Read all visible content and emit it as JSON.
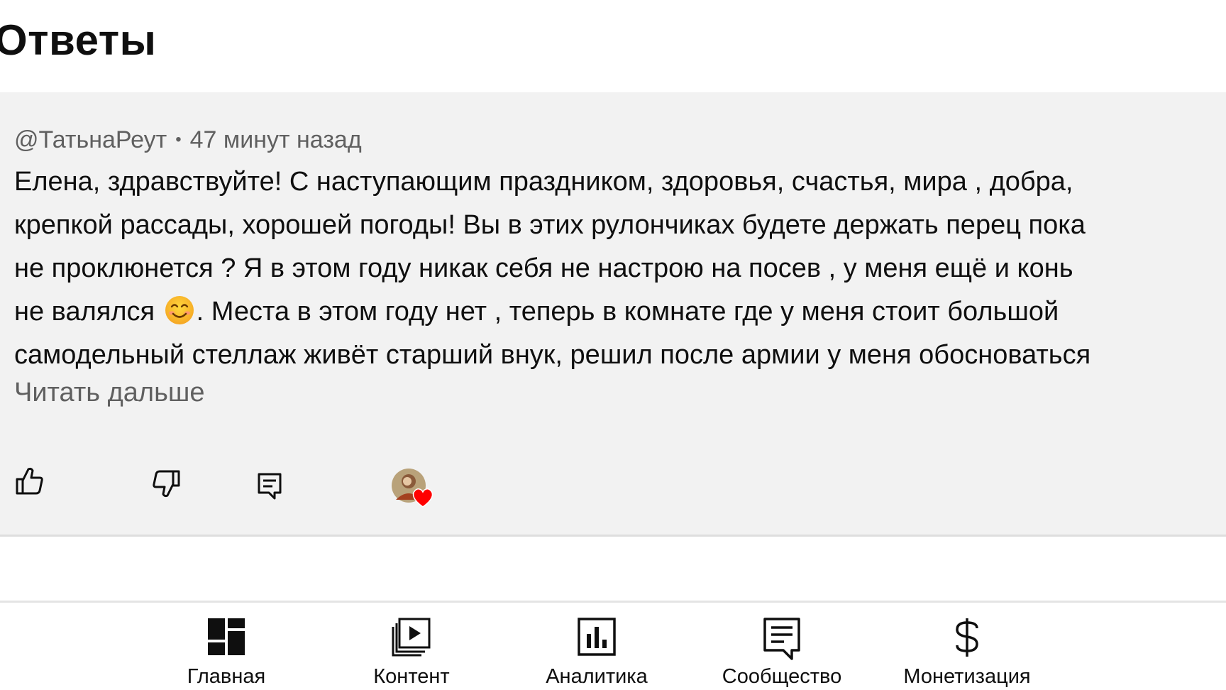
{
  "page": {
    "title": "Ответы"
  },
  "comment": {
    "author": "@ТатьнаРеут",
    "separator": "•",
    "time": "47 минут назад",
    "lines": [
      "Елена, здравствуйте! С наступающим праздником, здоровья, счастья, мира , добра,",
      "крепкой рассады, хорошей погоды! Вы в этих рулончиках будете держать перец пока",
      "не проклюнется ? Я в этом году никак себя не настрою на посев , у меня ещё и конь",
      "не валялся",
      ". Места в этом году нет , теперь в комнате где у меня стоит большой",
      "самодельный стеллаж живёт старший внук, решил после армии у меня обосноваться"
    ],
    "emoji": "smiling-face-emoji",
    "read_more": "Читать дальше",
    "actions": {
      "like_icon": "thumb-up-icon",
      "dislike_icon": "thumb-down-icon",
      "reply_icon": "reply-comment-icon",
      "hearted_icon": "creator-heart-icon",
      "heart_color": "#ff0000"
    }
  },
  "bottom_nav": {
    "items": [
      {
        "label": "Главная",
        "icon": "dashboard-icon"
      },
      {
        "label": "Контент",
        "icon": "content-library-icon"
      },
      {
        "label": "Аналитика",
        "icon": "analytics-icon"
      },
      {
        "label": "Сообщество",
        "icon": "community-icon"
      },
      {
        "label": "Монетизация",
        "icon": "dollar-icon"
      }
    ]
  }
}
